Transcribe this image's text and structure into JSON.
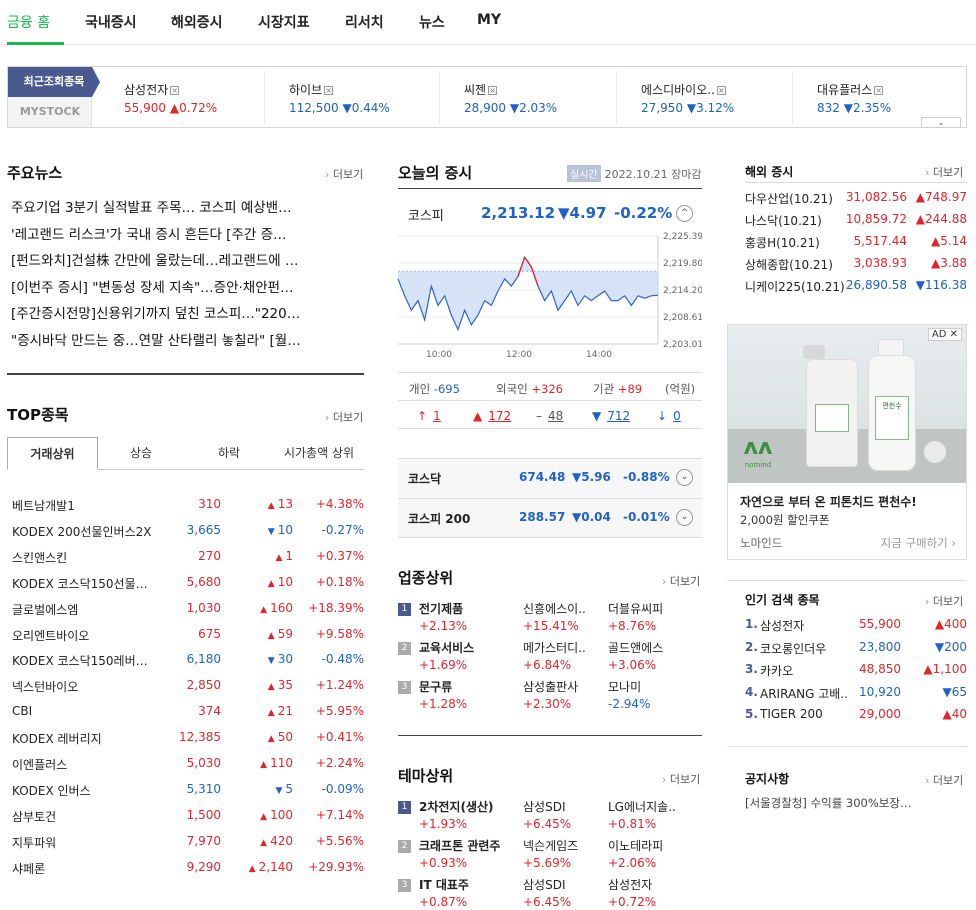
{
  "nav": {
    "tabs": [
      "금융 홈",
      "국내증시",
      "해외증시",
      "시장지표",
      "리서치",
      "뉴스",
      "MY"
    ]
  },
  "recent": {
    "tag_recent": "최근조회종목",
    "tag_mystock": "MYSTOCK",
    "items": [
      {
        "name": "삼성전자",
        "price": "55,900",
        "arrow": "▲",
        "change": "0.72%",
        "dir": "up"
      },
      {
        "name": "하이브",
        "price": "112,500",
        "arrow": "▼",
        "change": "0.44%",
        "dir": "dn"
      },
      {
        "name": "씨젠",
        "price": "28,900",
        "arrow": "▼",
        "change": "2.03%",
        "dir": "dn"
      },
      {
        "name": "에스디바이오..",
        "price": "27,950",
        "arrow": "▼",
        "change": "3.12%",
        "dir": "dn"
      },
      {
        "name": "대유플러스",
        "price": "832",
        "arrow": "▼",
        "change": "2.35%",
        "dir": "dn"
      }
    ],
    "close_glyph": "×",
    "expand_glyph": "⌄"
  },
  "more_label": "더보기",
  "news": {
    "title": "주요뉴스",
    "items": [
      "주요기업 3분기 실적발표 주목… 코스피 예상밴…",
      "'레고랜드 리스크'가 국내 증시 흔든다 [주간 증…",
      "[펀드와치]건설株 간만에 울랐는데…레고랜드에 …",
      "[이번주 증시] \"변동성 장세 지속\"…증안·채안펀…",
      "[주간증시전망]신용위기까지 덮친 코스피…\"220…",
      "\"증시바닥 만드는 중…연말 산타랠리 놓칠라\" [월…"
    ]
  },
  "top": {
    "title": "TOP종목",
    "tabs": [
      "거래상위",
      "상승",
      "하락",
      "시가총액 상위"
    ],
    "rows": [
      {
        "name": "베트남개발1",
        "price": "310",
        "arrow": "▲",
        "change": "13",
        "rate": "+4.38%",
        "dir": "up"
      },
      {
        "name": "KODEX 200선물인버스2X",
        "price": "3,665",
        "arrow": "▼",
        "change": "10",
        "rate": "-0.27%",
        "dir": "dn"
      },
      {
        "name": "스킨앤스킨",
        "price": "270",
        "arrow": "▲",
        "change": "1",
        "rate": "+0.37%",
        "dir": "up"
      },
      {
        "name": "KODEX 코스닥150선물…",
        "price": "5,680",
        "arrow": "▲",
        "change": "10",
        "rate": "+0.18%",
        "dir": "up"
      },
      {
        "name": "글로벌에스엠",
        "price": "1,030",
        "arrow": "▲",
        "change": "160",
        "rate": "+18.39%",
        "dir": "up"
      },
      {
        "name": "오리엔트바이오",
        "price": "675",
        "arrow": "▲",
        "change": "59",
        "rate": "+9.58%",
        "dir": "up"
      },
      {
        "name": "KODEX 코스닥150레버…",
        "price": "6,180",
        "arrow": "▼",
        "change": "30",
        "rate": "-0.48%",
        "dir": "dn"
      },
      {
        "name": "넥스턴바이오",
        "price": "2,850",
        "arrow": "▲",
        "change": "35",
        "rate": "+1.24%",
        "dir": "up"
      },
      {
        "name": "CBI",
        "price": "374",
        "arrow": "▲",
        "change": "21",
        "rate": "+5.95%",
        "dir": "up"
      },
      {
        "name": "KODEX 레버리지",
        "price": "12,385",
        "arrow": "▲",
        "change": "50",
        "rate": "+0.41%",
        "dir": "up"
      },
      {
        "name": "이엔플러스",
        "price": "5,030",
        "arrow": "▲",
        "change": "110",
        "rate": "+2.24%",
        "dir": "up"
      },
      {
        "name": "KODEX 인버스",
        "price": "5,310",
        "arrow": "▼",
        "change": "5",
        "rate": "-0.09%",
        "dir": "dn"
      },
      {
        "name": "삼부토건",
        "price": "1,500",
        "arrow": "▲",
        "change": "100",
        "rate": "+7.14%",
        "dir": "up"
      },
      {
        "name": "지투파워",
        "price": "7,970",
        "arrow": "▲",
        "change": "420",
        "rate": "+5.56%",
        "dir": "up"
      },
      {
        "name": "샤페론",
        "price": "9,290",
        "arrow": "▲",
        "change": "2,140",
        "rate": "+29.93%",
        "dir": "up"
      }
    ]
  },
  "market": {
    "title": "오늘의 증시",
    "live": "실시간",
    "date": "2022.10.21",
    "status": "장마감",
    "kospi": {
      "name": "코스피",
      "value": "2,213.12",
      "change": "▼4.97",
      "rate": "-0.22%"
    },
    "investors": {
      "personal_label": "개인",
      "personal": "-695",
      "foreign_label": "외국인",
      "foreign": "+326",
      "inst_label": "기관",
      "inst": "+89",
      "unit": "(억원)"
    },
    "breadth": [
      {
        "glyph": "↑",
        "value": "1",
        "dir": "up"
      },
      {
        "glyph": "▲",
        "value": "172",
        "dir": "up"
      },
      {
        "glyph": "–",
        "value": "48",
        "dir": "flat"
      },
      {
        "glyph": "▼",
        "value": "712",
        "dir": "dn"
      },
      {
        "glyph": "↓",
        "value": "0",
        "dir": "dn"
      }
    ],
    "kosdaq": {
      "name": "코스닥",
      "value": "674.48",
      "change": "▼5.96",
      "rate": "-0.88%"
    },
    "kospi200": {
      "name": "코스피 200",
      "value": "288.57",
      "change": "▼0.04",
      "rate": "-0.01%"
    },
    "toggle_up": "^",
    "toggle_down": "⌄"
  },
  "chart_data": {
    "type": "line",
    "yticks": [
      "2,225.39",
      "2,219.80",
      "2,214.20",
      "2,208.61",
      "2,203.01"
    ],
    "ylim": [
      2203.01,
      2225.39
    ],
    "xticks": [
      "10:00",
      "12:00",
      "14:00"
    ],
    "reference": 2218.09,
    "x": [
      "09:00",
      "09:10",
      "09:20",
      "09:30",
      "09:40",
      "09:50",
      "10:00",
      "10:10",
      "10:20",
      "10:30",
      "10:40",
      "10:50",
      "11:00",
      "11:10",
      "11:20",
      "11:30",
      "11:40",
      "11:50",
      "12:00",
      "12:10",
      "12:20",
      "12:30",
      "12:40",
      "12:50",
      "13:00",
      "13:10",
      "13:20",
      "13:30",
      "13:40",
      "13:50",
      "14:00",
      "14:10",
      "14:20",
      "14:30",
      "14:40",
      "14:50",
      "15:00",
      "15:10",
      "15:20",
      "15:30"
    ],
    "values": [
      2216.5,
      2213,
      2210,
      2212,
      2208,
      2215,
      2211,
      2213,
      2209,
      2206,
      2210,
      2207,
      2209,
      2212,
      2211,
      2214,
      2216.5,
      2215,
      2217,
      2221,
      2219,
      2215,
      2212,
      2214,
      2210,
      2212,
      2214,
      2211,
      2213,
      2212,
      2213,
      2214,
      2212,
      2212,
      2213,
      2211,
      2213,
      2212.5,
      2213,
      2213.12
    ]
  },
  "sector": {
    "title": "업종상위",
    "rows": [
      {
        "rank": "1",
        "name": "전기제품",
        "rate": "+2.13%",
        "s1": "신흥에스이..",
        "r1": "+15.41%",
        "s2": "더블유씨피",
        "r2": "+8.76%",
        "d2": "up"
      },
      {
        "rank": "2",
        "name": "교육서비스",
        "rate": "+1.69%",
        "s1": "메가스터디..",
        "r1": "+6.84%",
        "s2": "골드앤에스",
        "r2": "+3.06%",
        "d2": "up"
      },
      {
        "rank": "3",
        "name": "문구류",
        "rate": "+1.28%",
        "s1": "삼성출판사",
        "r1": "+2.30%",
        "s2": "모나미",
        "r2": "-2.94%",
        "d2": "dn"
      }
    ]
  },
  "theme": {
    "title": "테마상위",
    "rows": [
      {
        "rank": "1",
        "name": "2차전지(생산)",
        "rate": "+1.93%",
        "s1": "삼성SDI",
        "r1": "+6.45%",
        "s2": "LG에너지솔..",
        "r2": "+0.81%",
        "d2": "up"
      },
      {
        "rank": "2",
        "name": "크래프톤 관련주",
        "rate": "+0.93%",
        "s1": "넥슨게임즈",
        "r1": "+5.69%",
        "s2": "이노테라피",
        "r2": "+2.06%",
        "d2": "up"
      },
      {
        "rank": "3",
        "name": "IT 대표주",
        "rate": "+0.87%",
        "s1": "삼성SDI",
        "r1": "+6.45%",
        "s2": "삼성전자",
        "r2": "+0.72%",
        "d2": "up"
      }
    ]
  },
  "world": {
    "title": "해외 증시",
    "rows": [
      {
        "name": "다우산업(10.21)",
        "price": "31,082.56",
        "change": "▲748.97",
        "dir": "up"
      },
      {
        "name": "나스닥(10.21)",
        "price": "10,859.72",
        "change": "▲244.88",
        "dir": "up"
      },
      {
        "name": "홍콩H(10.21)",
        "price": "5,517.44",
        "change": "▲5.14",
        "dir": "up"
      },
      {
        "name": "상해종합(10.21)",
        "price": "3,038.93",
        "change": "▲3.88",
        "dir": "up"
      },
      {
        "name": "니케이225(10.21)",
        "price": "26,890.58",
        "change": "▼116.38",
        "dir": "dn"
      }
    ]
  },
  "ad": {
    "badge": "AD",
    "close": "✕",
    "headline": "자연으로 부터 온 피톤치드 편천수!",
    "sub": "2,000원 할인쿠폰",
    "brand": "노마인드",
    "cta": "지금 구매하기 ›",
    "logo_text": "nomind",
    "product_label": "편천수"
  },
  "popular": {
    "title": "인기 검색 종목",
    "rows": [
      {
        "rank": "1.",
        "name": "삼성전자",
        "price": "55,900",
        "change": "▲400",
        "dir": "up"
      },
      {
        "rank": "2.",
        "name": "코오롱인더우",
        "price": "23,800",
        "change": "▼200",
        "dir": "dn"
      },
      {
        "rank": "3.",
        "name": "카카오",
        "price": "48,850",
        "change": "▲1,100",
        "dir": "up"
      },
      {
        "rank": "4.",
        "name": "ARIRANG 고배..",
        "price": "10,920",
        "change": "▼65",
        "dir": "dn"
      },
      {
        "rank": "5.",
        "name": "TIGER 200",
        "price": "29,000",
        "change": "▲40",
        "dir": "up"
      }
    ]
  },
  "notice": {
    "title": "공지사항",
    "item": "[서울경찰청] 수익률 300%보장…"
  }
}
